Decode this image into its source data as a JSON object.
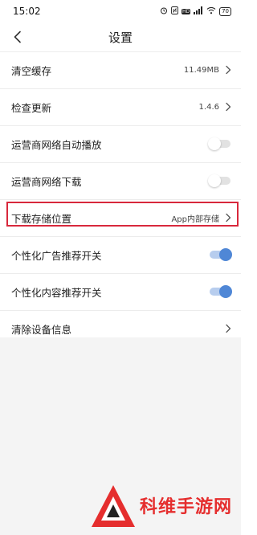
{
  "status_bar": {
    "time": "15:02",
    "icons": [
      "alarm-icon",
      "nfc-icon",
      "hd-icon",
      "signal-icon",
      "wifi-icon",
      "battery-icon"
    ],
    "hd_label": "HD",
    "battery": "70"
  },
  "header": {
    "back_icon": "chevron-left-icon",
    "title": "设置"
  },
  "settings": {
    "items": [
      {
        "label": "清空缓存",
        "value": "11.49MB",
        "control": "chevron"
      },
      {
        "label": "检查更新",
        "value": "1.4.6",
        "control": "chevron"
      },
      {
        "label": "运营商网络自动播放",
        "control": "toggle",
        "on": false
      },
      {
        "label": "运营商网络下载",
        "control": "toggle",
        "on": false
      },
      {
        "label": "下载存储位置",
        "value": "App内部存储",
        "control": "chevron",
        "highlighted": true
      },
      {
        "label": "个性化广告推荐开关",
        "control": "toggle",
        "on": true
      },
      {
        "label": "个性化内容推荐开关",
        "control": "toggle",
        "on": true
      },
      {
        "label": "清除设备信息",
        "control": "chevron"
      }
    ]
  },
  "colors": {
    "toggle_on": "#4f87d6",
    "toggle_off": "#e2e2e2",
    "highlight": "#d8283c",
    "watermark": "#e52e2e"
  },
  "watermark": {
    "logo_icon": "triangle-logo-icon",
    "text": "科维手游网"
  }
}
